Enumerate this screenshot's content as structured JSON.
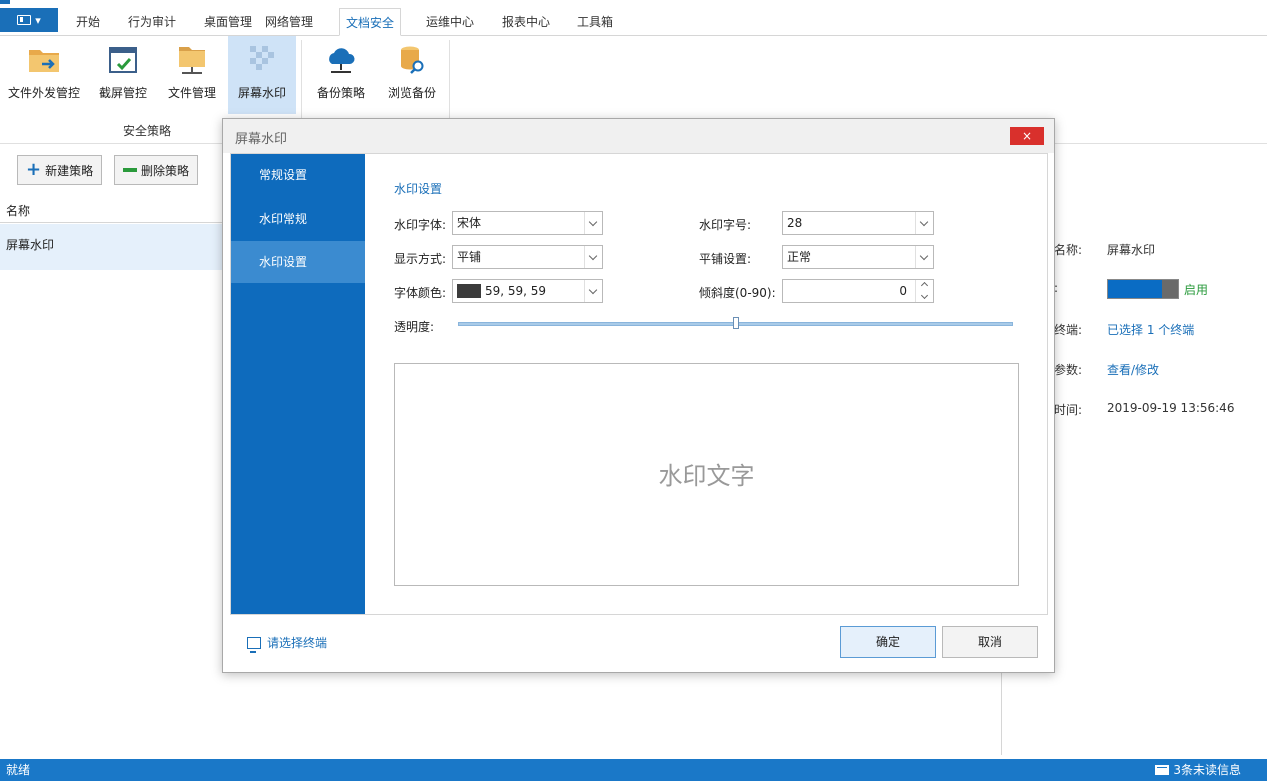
{
  "menu": {
    "app_button": "",
    "tabs": [
      {
        "label": "开始"
      },
      {
        "label": "行为审计"
      },
      {
        "label": "桌面管理"
      },
      {
        "label": "网络管理"
      },
      {
        "label": "文档安全"
      },
      {
        "label": "运维中心"
      },
      {
        "label": "报表中心"
      },
      {
        "label": "工具箱"
      }
    ],
    "active_tab": "文档安全"
  },
  "ribbon": {
    "buttons": [
      {
        "label": "文件外发管控",
        "icon": "folder-arrow-icon"
      },
      {
        "label": "截屏管控",
        "icon": "screenshot-icon"
      },
      {
        "label": "文件管理",
        "icon": "folder-network-icon"
      },
      {
        "label": "屏幕水印",
        "icon": "watermark-icon"
      },
      {
        "label": "备份策略",
        "icon": "cloud-icon"
      },
      {
        "label": "浏览备份",
        "icon": "database-search-icon"
      }
    ],
    "group_label": "安全策略"
  },
  "toolbar": {
    "new_label": "新建策略",
    "delete_label": "删除策略"
  },
  "list": {
    "header": "名称",
    "items": [
      "屏幕水印"
    ]
  },
  "details": {
    "name_label": "名称:",
    "name_value": "屏幕水印",
    "status_label": ":",
    "status_value": "启用",
    "terminal_label": "终端:",
    "terminal_value": "已选择 1 个终端",
    "params_label": "参数:",
    "params_value": "查看/修改",
    "time_label": "时间:",
    "time_value": "2019-09-19 13:56:46"
  },
  "status": {
    "left": "就绪",
    "right": "3条未读信息"
  },
  "dialog": {
    "title": "屏幕水印",
    "close_label": "×",
    "nav": [
      "常规设置",
      "水印常规",
      "水印设置"
    ],
    "nav_selected": 2,
    "section_title": "水印设置",
    "font_label": "水印字体:",
    "font_value": "宋体",
    "size_label": "水印字号:",
    "size_value": "28",
    "display_label": "显示方式:",
    "display_value": "平铺",
    "tile_label": "平铺设置:",
    "tile_value": "正常",
    "color_label": "字体颜色:",
    "color_value": "59, 59, 59",
    "color_hex": "#3b3b3b",
    "tilt_label": "倾斜度(0-90):",
    "tilt_value": "0",
    "opacity_label": "透明度:",
    "opacity_value": 0.5,
    "preview_text": "水印文字",
    "footer_link": "请选择终端",
    "ok_label": "确定",
    "cancel_label": "取消"
  },
  "colors": {
    "accent": "#1a6fb8",
    "nav_bg": "#0e6bbd",
    "status_bar": "#1a78c8",
    "close_red": "#d9302c",
    "enabled_green": "#2a9a3c"
  }
}
